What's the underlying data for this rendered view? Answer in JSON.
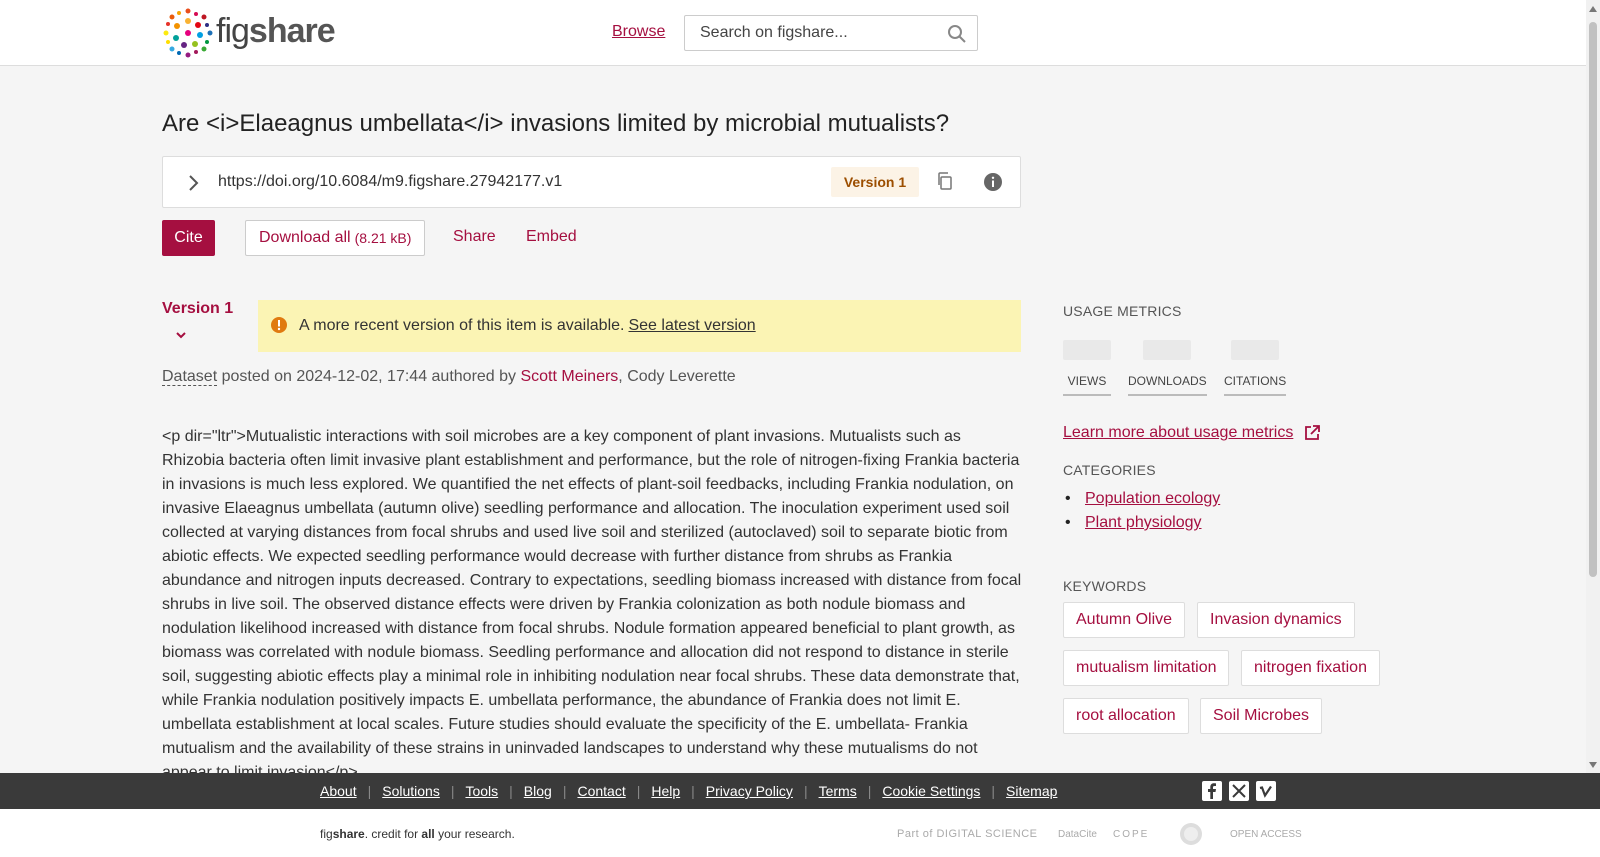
{
  "header": {
    "logo_text_regular": "fig",
    "logo_text_bold": "share",
    "browse_label": "Browse",
    "search_placeholder": "Search on figshare..."
  },
  "item": {
    "title": "Are <i>Elaeagnus umbellata</i> invasions limited by microbial mutualists?",
    "doi_url": "https://doi.org/10.6084/m9.figshare.27942177.v1",
    "version_badge": "Version 1"
  },
  "actions": {
    "cite_label": "Cite",
    "download_label": "Download all",
    "download_size": "(8.21 kB)",
    "share_label": "Share",
    "embed_label": "Embed"
  },
  "version_notice": {
    "toggle_label": "Version 1",
    "message": "A more recent version of this item is available.",
    "link_label": "See latest version"
  },
  "posted": {
    "item_type": "Dataset",
    "text": " posted on 2024-12-02, 17:44 authored by ",
    "author_1": "Scott Meiners",
    "separator": ", ",
    "author_2": "Cody Leverette"
  },
  "description": "<p dir=\"ltr\">Mutualistic interactions with soil microbes are a key component of plant invasions. Mutualists such as Rhizobia bacteria often limit invasive plant establishment and performance, but the role of nitrogen-fixing Frankia bacteria in invasions is much less explored. We quantified the net effects of plant-soil feedbacks, including Frankia nodulation, on invasive Elaeagnus umbellata (autumn olive) seedling performance and allocation. The inoculation experiment used soil collected at varying distances from focal shrubs and used live soil and sterilized (autoclaved) soil to separate biotic from abiotic effects. We expected seedling performance would decrease with further distance from shrubs as Frankia abundance and nitrogen inputs decreased. Contrary to expectations, seedling biomass increased with distance from focal shrubs in live soil. The observed distance effects were driven by Frankia colonization as both nodule biomass and nodulation likelihood increased with distance from focal shrubs. Nodule formation appeared beneficial to plant growth, as biomass was correlated with nodule biomass. Seedling performance and allocation did not respond to distance in sterile soil, suggesting abiotic effects play a minimal role in inhibiting nodulation near focal shrubs. These data demonstrate that, while Frankia nodulation positively impacts E. umbellata performance, the abundance of Frankia does not limit E. umbellata establishment at local scales. Future studies should evaluate the specificity of the E. umbellata- Frankia mutualism and the availability of these strains in uninvaded landscapes to understand why these mutualisms do not appear to limit invasion</p>",
  "sidebar": {
    "usage_metrics_label": "USAGE METRICS",
    "metrics": [
      "VIEWS",
      "DOWNLOADS",
      "CITATIONS"
    ],
    "learn_more_label": "Learn more about usage metrics",
    "categories_label": "CATEGORIES",
    "categories": [
      "Population ecology",
      "Plant physiology"
    ],
    "keywords_label": "KEYWORDS",
    "keywords": [
      "Autumn Olive",
      "Invasion dynamics",
      "mutualism limitation",
      "nitrogen fixation",
      "root allocation",
      "Soil Microbes"
    ]
  },
  "footer": {
    "links": [
      "About",
      "Solutions",
      "Tools",
      "Blog",
      "Contact",
      "Help",
      "Privacy Policy",
      "Terms",
      "Cookie Settings",
      "Sitemap"
    ],
    "tagline_fig": "fig",
    "tagline_share": "share",
    "tagline_mid": ". credit for ",
    "tagline_all": "all",
    "tagline_end": " your research.",
    "partners": [
      "Part of DIGITAL SCIENCE",
      "DataCite",
      "COPE",
      "",
      "OPEN ACCESS"
    ],
    "social_icons": [
      "facebook-icon",
      "x-icon",
      "vimeo-icon"
    ]
  },
  "colors": {
    "brand": "#a50f40",
    "notice_bg": "#fbf4b4",
    "version_pill_bg": "#fcf3e6",
    "version_pill_text": "#9c4e00",
    "footer_bg": "#3a3a3a"
  }
}
